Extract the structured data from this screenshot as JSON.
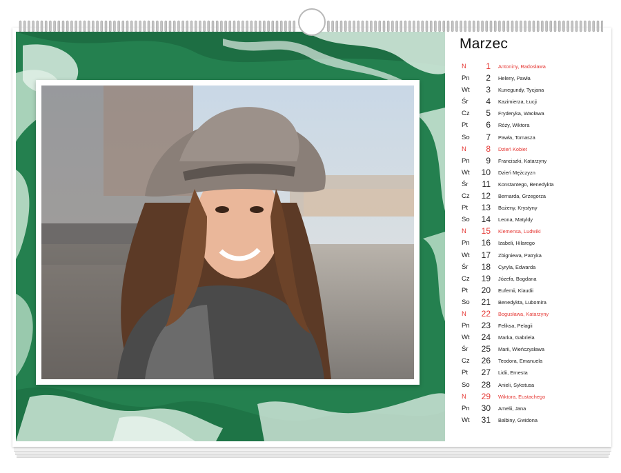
{
  "calendar": {
    "month": "Marzec",
    "days": [
      {
        "dn": "N",
        "num": "1",
        "names": "Antoniny, Radosława",
        "holiday": true
      },
      {
        "dn": "Pn",
        "num": "2",
        "names": "Heleny, Pawła",
        "holiday": false
      },
      {
        "dn": "Wt",
        "num": "3",
        "names": "Kunegundy, Tycjana",
        "holiday": false
      },
      {
        "dn": "Śr",
        "num": "4",
        "names": "Kazimierza, Łucji",
        "holiday": false
      },
      {
        "dn": "Cz",
        "num": "5",
        "names": "Fryderyka, Wacława",
        "holiday": false
      },
      {
        "dn": "Pt",
        "num": "6",
        "names": "Róży, Wiktora",
        "holiday": false
      },
      {
        "dn": "So",
        "num": "7",
        "names": "Pawła, Tomasza",
        "holiday": false
      },
      {
        "dn": "N",
        "num": "8",
        "names": "Dzień Kobiet",
        "holiday": true
      },
      {
        "dn": "Pn",
        "num": "9",
        "names": "Franciszki, Katarzyny",
        "holiday": false
      },
      {
        "dn": "Wt",
        "num": "10",
        "names": "Dzień Mężczyzn",
        "holiday": false
      },
      {
        "dn": "Śr",
        "num": "11",
        "names": "Konstantego, Benedykta",
        "holiday": false
      },
      {
        "dn": "Cz",
        "num": "12",
        "names": "Bernarda, Grzegorza",
        "holiday": false
      },
      {
        "dn": "Pt",
        "num": "13",
        "names": "Bożeny, Krystyny",
        "holiday": false
      },
      {
        "dn": "So",
        "num": "14",
        "names": "Leona, Matyldy",
        "holiday": false
      },
      {
        "dn": "N",
        "num": "15",
        "names": "Klemensa, Ludwiki",
        "holiday": true
      },
      {
        "dn": "Pn",
        "num": "16",
        "names": "Izabeli, Hilarego",
        "holiday": false
      },
      {
        "dn": "Wt",
        "num": "17",
        "names": "Zbigniewa, Patryka",
        "holiday": false
      },
      {
        "dn": "Śr",
        "num": "18",
        "names": "Cyryla, Edwarda",
        "holiday": false
      },
      {
        "dn": "Cz",
        "num": "19",
        "names": "Józefa, Bogdana",
        "holiday": false
      },
      {
        "dn": "Pt",
        "num": "20",
        "names": "Eufemii, Klaudii",
        "holiday": false
      },
      {
        "dn": "So",
        "num": "21",
        "names": "Benedykta, Lubomira",
        "holiday": false
      },
      {
        "dn": "N",
        "num": "22",
        "names": "Bogusława, Katarzyny",
        "holiday": true
      },
      {
        "dn": "Pn",
        "num": "23",
        "names": "Feliksa, Pelagii",
        "holiday": false
      },
      {
        "dn": "Wt",
        "num": "24",
        "names": "Marka, Gabriela",
        "holiday": false
      },
      {
        "dn": "Śr",
        "num": "25",
        "names": "Marii, Wieńczysława",
        "holiday": false
      },
      {
        "dn": "Cz",
        "num": "26",
        "names": "Teodora, Emanuela",
        "holiday": false
      },
      {
        "dn": "Pt",
        "num": "27",
        "names": "Lidii, Ernesta",
        "holiday": false
      },
      {
        "dn": "So",
        "num": "28",
        "names": "Anieli, Sykstusa",
        "holiday": false
      },
      {
        "dn": "N",
        "num": "29",
        "names": "Wiktora, Eustachego",
        "holiday": true
      },
      {
        "dn": "Pn",
        "num": "30",
        "names": "Amelii, Jana",
        "holiday": false
      },
      {
        "dn": "Wt",
        "num": "31",
        "names": "Balbiny, Gwidona",
        "holiday": false
      }
    ]
  },
  "colors": {
    "marble_green": "#2d8f5d",
    "marble_light": "#c9e2d3",
    "holiday_red": "#e53935",
    "text": "#222222"
  }
}
